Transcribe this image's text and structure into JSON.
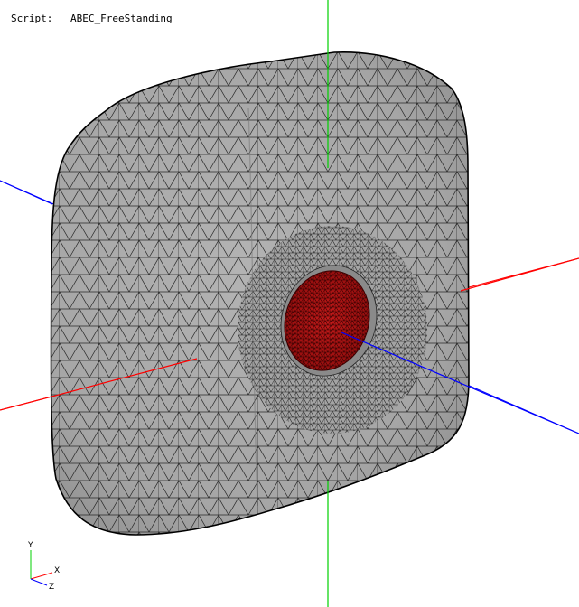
{
  "script": {
    "label": "Script:",
    "value": "ABEC_FreeStanding"
  },
  "triad": {
    "x_label": "X",
    "y_label": "Y",
    "z_label": "Z"
  },
  "colors": {
    "background": "#ffffff",
    "mesh_surface": "#a9a9a9",
    "mesh_edge": "#1a1a1a",
    "driver": "#b01414",
    "axis_x": "#ff0000",
    "axis_y": "#00d000",
    "axis_z": "#0000ff"
  },
  "scene": {
    "object": "free-standing cabinet mesh",
    "driver": "red driver mesh on front face"
  }
}
